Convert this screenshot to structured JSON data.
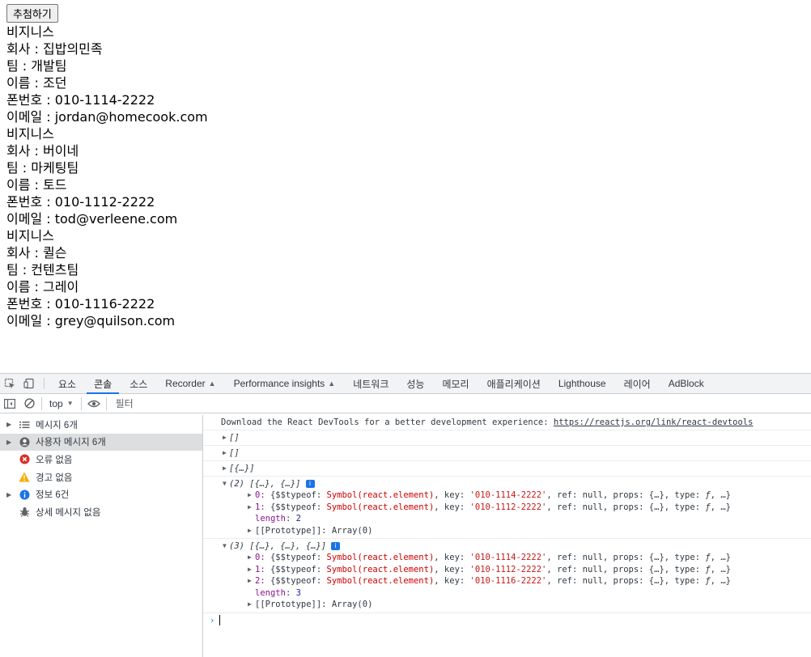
{
  "page": {
    "button_label": "추첨하기",
    "cards": [
      {
        "category": "비지니스",
        "company": "회사 : 집밥의민족",
        "team": "팀 : 개발팀",
        "name": "이름 : 조던",
        "phone": "폰번호 : 010-1114-2222",
        "email": "이메일 : jordan@homecook.com"
      },
      {
        "category": "비지니스",
        "company": "회사 : 버이네",
        "team": "팀 : 마케팅팀",
        "name": "이름 : 토드",
        "phone": "폰번호 : 010-1112-2222",
        "email": "이메일 : tod@verleene.com"
      },
      {
        "category": "비지니스",
        "company": "회사 : 퀼슨",
        "team": "팀 : 컨텐츠팀",
        "name": "이름 : 그레이",
        "phone": "폰번호 : 010-1116-2222",
        "email": "이메일 : grey@quilson.com"
      }
    ]
  },
  "devtools": {
    "tabs": [
      "요소",
      "콘솔",
      "소스",
      "Recorder",
      "Performance insights",
      "네트워크",
      "성능",
      "메모리",
      "애플리케이션",
      "Lighthouse",
      "레이어",
      "AdBlock"
    ],
    "active_tab": "콘솔",
    "context": "top",
    "filter_placeholder": "필터",
    "sidebar": {
      "messages": "메시지 6개",
      "user_messages": "사용자 메시지 6개",
      "errors": "오류 없음",
      "warnings": "경고 없음",
      "info": "정보 6건",
      "verbose": "상세 메시지 없음"
    },
    "console": {
      "react_msg": "Download the React DevTools for a better development experience: ",
      "react_link": "https://reactjs.org/link/react-devtools",
      "empty1": "[]",
      "empty2": "[]",
      "single": "[{…}]",
      "arr2_header": "(2) [{…}, {…}]",
      "arr2_items": [
        {
          "idx": "0: ",
          "key": "'010-1114-2222'"
        },
        {
          "idx": "1: ",
          "key": "'010-1112-2222'"
        }
      ],
      "arr2_length": "2",
      "arr3_header": "(3) [{…}, {…}, {…}]",
      "arr3_items": [
        {
          "idx": "0: ",
          "key": "'010-1114-2222'"
        },
        {
          "idx": "1: ",
          "key": "'010-1112-2222'"
        },
        {
          "idx": "2: ",
          "key": "'010-1116-2222'"
        }
      ],
      "arr3_length": "3",
      "prototype": "Array(0)",
      "prompt_glyph": "›"
    }
  }
}
